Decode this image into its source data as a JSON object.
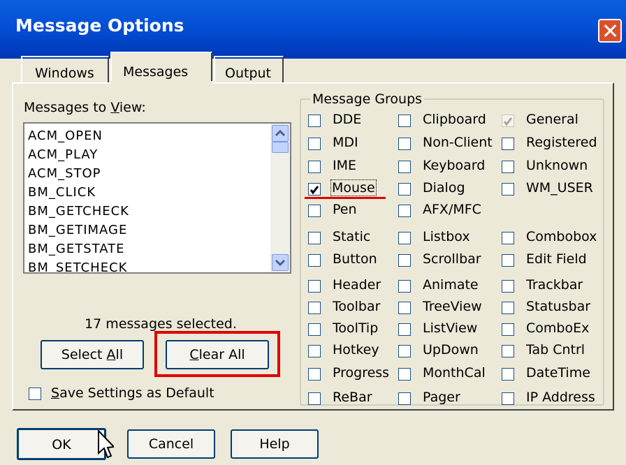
{
  "window": {
    "title": "Message Options"
  },
  "tabs": [
    {
      "label": "Windows"
    },
    {
      "label": "Messages"
    },
    {
      "label": "Output"
    }
  ],
  "messages_panel": {
    "label_prefix": "Messages to ",
    "label_underlined": "V",
    "label_suffix": "iew:",
    "items": [
      "ACM_OPEN",
      "ACM_PLAY",
      "ACM_STOP",
      "BM_CLICK",
      "BM_GETCHECK",
      "BM_GETIMAGE",
      "BM_GETSTATE",
      "BM_SETCHECK"
    ],
    "status": "17 messages selected.",
    "select_all_prefix": "Select ",
    "select_all_underlined": "A",
    "select_all_suffix": "ll",
    "clear_all_underlined": "C",
    "clear_all_suffix": "lear All",
    "save_underlined": "S",
    "save_suffix": "ave Settings as Default",
    "save_checked": false
  },
  "message_groups": {
    "title": "Message Groups",
    "items": [
      {
        "label": "DDE",
        "checked": false
      },
      {
        "label": "Clipboard",
        "checked": false
      },
      {
        "label": "General",
        "checked": true,
        "disabled": true
      },
      {
        "label": "MDI",
        "checked": false
      },
      {
        "label": "Non-Client",
        "checked": false
      },
      {
        "label": "Registered",
        "checked": false
      },
      {
        "label": "IME",
        "checked": false
      },
      {
        "label": "Keyboard",
        "checked": false
      },
      {
        "label": "Unknown",
        "checked": false
      },
      {
        "label": "Mouse",
        "checked": true
      },
      {
        "label": "Dialog",
        "checked": false
      },
      {
        "label": "WM_USER",
        "checked": false
      },
      {
        "label": "Pen",
        "checked": false
      },
      {
        "label": "AFX/MFC",
        "checked": false
      },
      {
        "label": "Static",
        "checked": false
      },
      {
        "label": "Listbox",
        "checked": false
      },
      {
        "label": "Combobox",
        "checked": false
      },
      {
        "label": "Button",
        "checked": false
      },
      {
        "label": "Scrollbar",
        "checked": false
      },
      {
        "label": "Edit Field",
        "checked": false
      },
      {
        "label": "Header",
        "checked": false
      },
      {
        "label": "Animate",
        "checked": false
      },
      {
        "label": "Trackbar",
        "checked": false
      },
      {
        "label": "Toolbar",
        "checked": false
      },
      {
        "label": "TreeView",
        "checked": false
      },
      {
        "label": "Statusbar",
        "checked": false
      },
      {
        "label": "ToolTip",
        "checked": false
      },
      {
        "label": "ListView",
        "checked": false
      },
      {
        "label": "ComboEx",
        "checked": false
      },
      {
        "label": "Hotkey",
        "checked": false
      },
      {
        "label": "UpDown",
        "checked": false
      },
      {
        "label": "Tab Cntrl",
        "checked": false
      },
      {
        "label": "Progress",
        "checked": false
      },
      {
        "label": "MonthCal",
        "checked": false
      },
      {
        "label": "DateTime",
        "checked": false
      },
      {
        "label": "ReBar",
        "checked": false
      },
      {
        "label": "Pager",
        "checked": false
      },
      {
        "label": "IP Address",
        "checked": false
      }
    ]
  },
  "buttons": {
    "ok": "OK",
    "cancel": "Cancel",
    "help": "Help"
  },
  "colors": {
    "titlebar": "#0451D6",
    "close": "#D9512C",
    "annotation": "#E00000",
    "dialog_bg": "#ECE9D8"
  }
}
